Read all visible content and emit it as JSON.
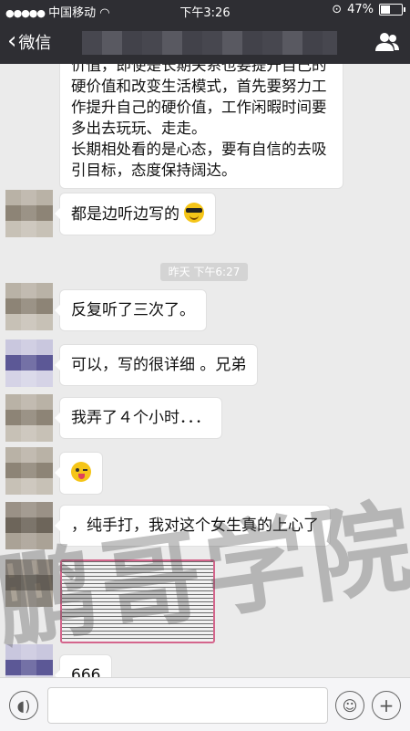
{
  "status_bar": {
    "carrier": "中国移动",
    "time": "下午3:26",
    "battery": "47%",
    "battery_level": 0.47
  },
  "nav": {
    "back_label": "微信"
  },
  "messages": {
    "long_text": "价值，即使是长期关系也要提升自己的硬价值和改变生活模式，首先要努力工作提升自己的硬价值，工作闲暇时间要多出去玩玩、走走。\n长期相处看的是心态，要有自信的去吸引目标，态度保持阔达。",
    "m1": "都是边听边写的",
    "timestamp": "昨天 下午6:27",
    "m2": "反复听了三次了。",
    "m3": "可以，写的很详细 。兄弟",
    "m4": "我弄了４个小时．．．",
    "m6": "，纯手打，我对这个女生真的上心了",
    "m7": "666"
  },
  "watermark": "鹏哥学院"
}
